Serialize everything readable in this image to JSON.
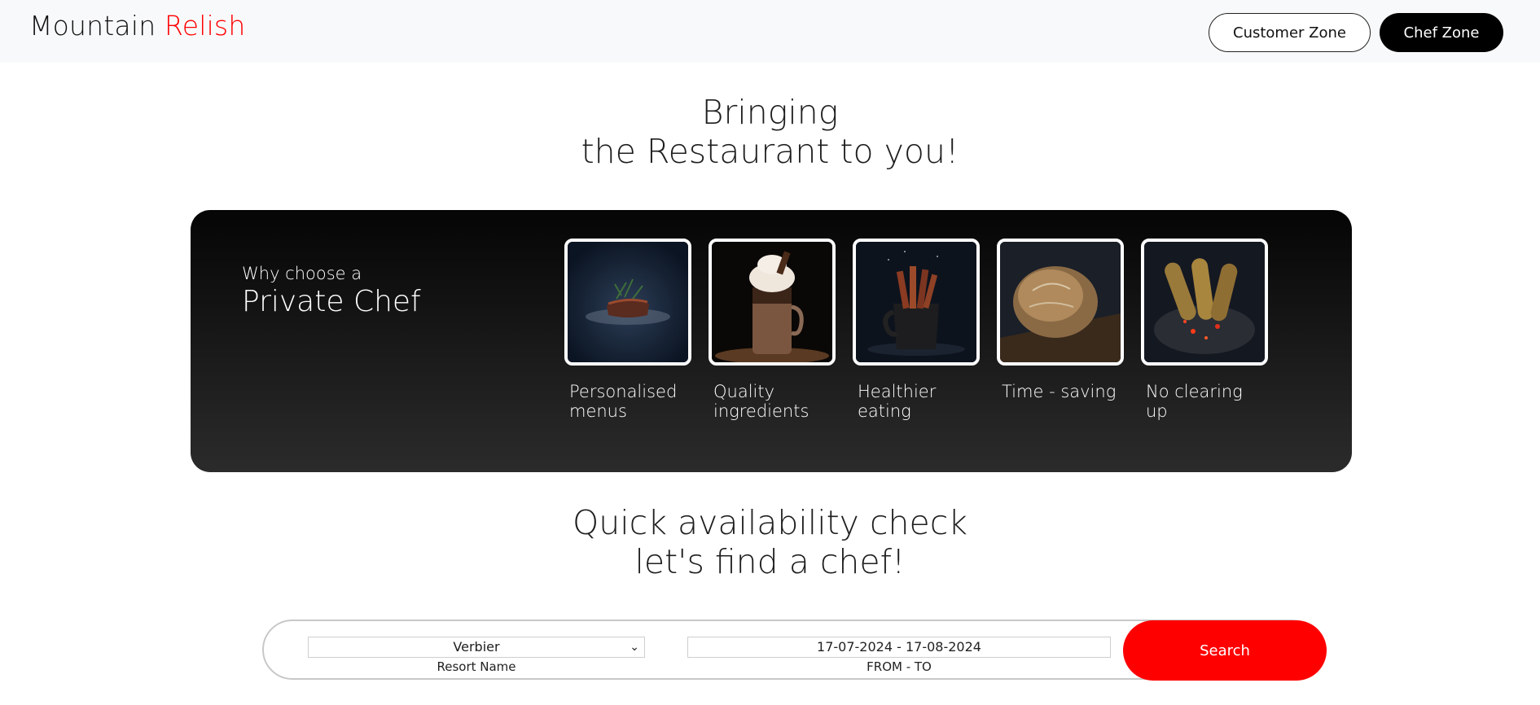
{
  "brand": {
    "name_part1": "Mountain",
    "name_part2": "Relish",
    "accent_color": "#ff0000"
  },
  "nav": {
    "customer_zone": "Customer Zone",
    "chef_zone": "Chef Zone"
  },
  "hero": {
    "line1": "Bringing",
    "line2": "the Restaurant to you!"
  },
  "why": {
    "small": "Why choose a",
    "big": "Private Chef",
    "features": [
      {
        "line1": "Personalised",
        "line2": "menus",
        "image": "steak-image"
      },
      {
        "line1": "Quality",
        "line2": "ingredients",
        "image": "milkshake-image"
      },
      {
        "line1": "Healthier",
        "line2": "eating",
        "image": "cinnamon-jug-image"
      },
      {
        "line1": "Time - saving",
        "line2": "",
        "image": "bread-image"
      },
      {
        "line1": "No clearing",
        "line2": "up",
        "image": "grilled-corn-image"
      }
    ]
  },
  "availability": {
    "line1": "Quick availability check",
    "line2": "let's find a chef!",
    "resort_value": "Verbier",
    "resort_label": "Resort Name",
    "date_value": "17-07-2024 - 17-08-2024",
    "date_label": "FROM - TO",
    "search_label": "Search"
  }
}
